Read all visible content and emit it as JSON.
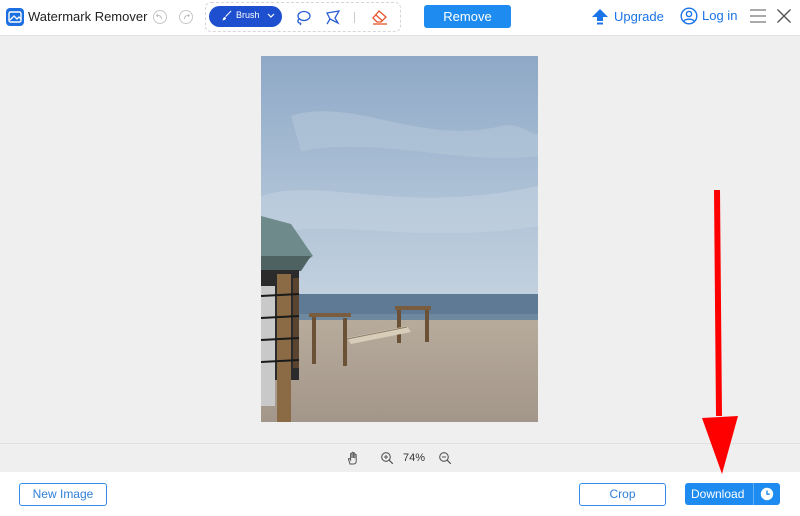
{
  "app": {
    "title": "Watermark Remover"
  },
  "toolbar": {
    "undo_icon": "undo-icon",
    "redo_icon": "redo-icon",
    "brush_label": "Brush",
    "tools": [
      "brush-icon",
      "lasso-icon",
      "polygon-lasso-icon",
      "eraser-icon"
    ],
    "remove_label": "Remove",
    "upgrade_label": "Upgrade",
    "login_label": "Log in"
  },
  "zoom": {
    "value": "74%"
  },
  "bottom": {
    "new_image_label": "New Image",
    "crop_label": "Crop",
    "download_label": "Download"
  },
  "colors": {
    "accent": "#1d8bf0",
    "brush_active": "#1e4fcf",
    "link": "#1a73e8",
    "eraser": "#e8542a",
    "annotation_arrow": "#ff0000"
  }
}
